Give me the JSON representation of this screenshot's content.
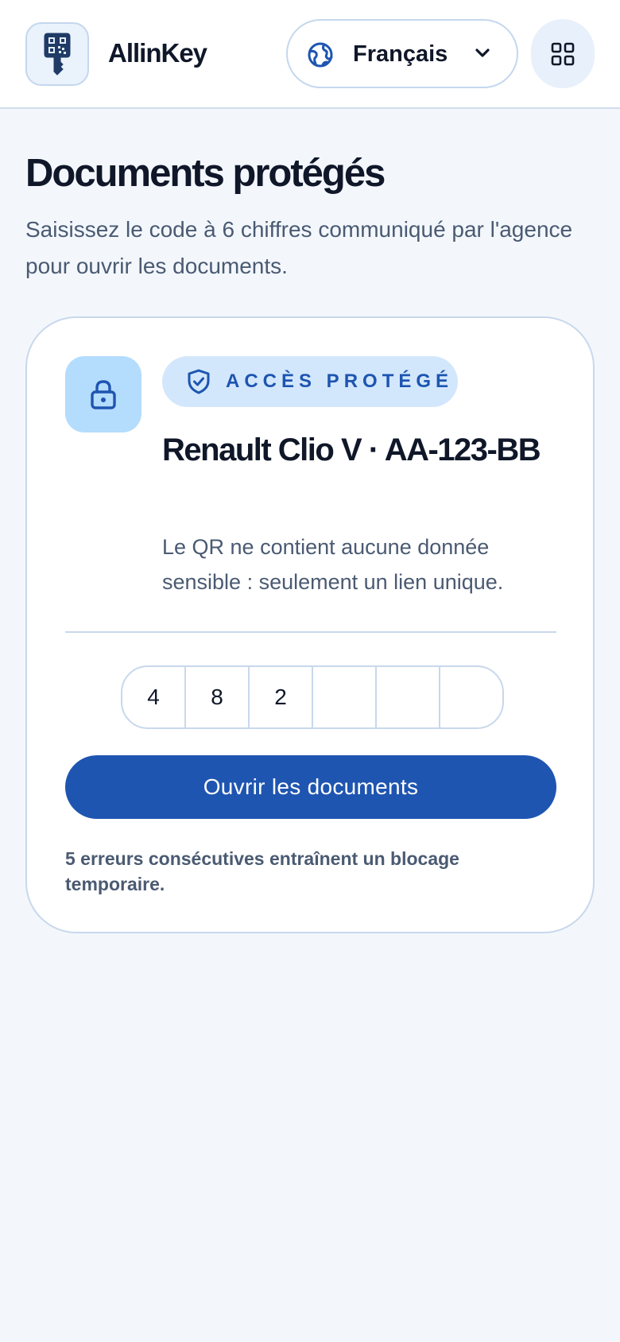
{
  "header": {
    "brand": "AllinKey",
    "language": {
      "selected": "Français",
      "icon": "globe-icon"
    },
    "menu_icon": "grid-icon",
    "logo_icon": "key-qr-icon"
  },
  "page": {
    "title": "Documents protégés",
    "subtitle": "Saisissez le code à 6 chiffres communiqué par l'agence pour ouvrir les documents."
  },
  "card": {
    "badge": "ACCÈS PROTÉGÉ",
    "vehicle": "Renault Clio V · AA-123-BB",
    "note": "Le QR ne contient aucune donnée sensible : seulement un lien unique.",
    "code_digits": [
      "4",
      "8",
      "2",
      "",
      "",
      ""
    ],
    "submit_label": "Ouvrir les documents",
    "warning": "5 erreurs consécutives entraînent un blocage temporaire."
  },
  "colors": {
    "primary": "#1e55b0",
    "badge_bg": "#d3e7fc",
    "lock_tile": "#b4dcfd",
    "page_bg": "#f3f7fc"
  }
}
